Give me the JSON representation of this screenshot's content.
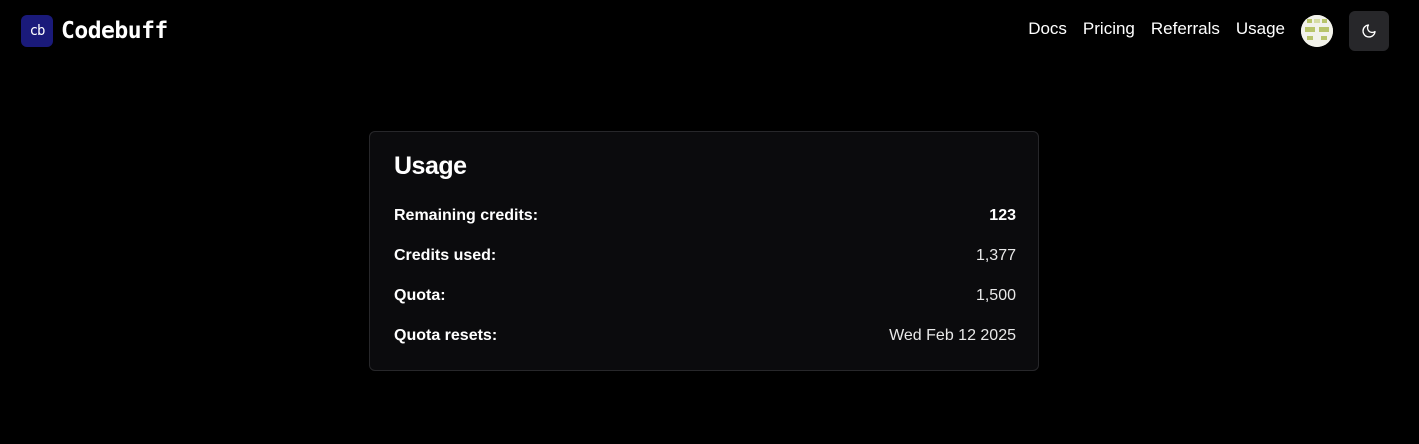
{
  "header": {
    "logo_text": "cb",
    "brand_name": "Codebuff",
    "nav": [
      {
        "label": "Docs"
      },
      {
        "label": "Pricing"
      },
      {
        "label": "Referrals"
      },
      {
        "label": "Usage"
      }
    ],
    "avatar_icon": "user-avatar",
    "theme_toggle_icon": "moon-icon"
  },
  "usage": {
    "title": "Usage",
    "rows": [
      {
        "label": "Remaining credits:",
        "value": "123"
      },
      {
        "label": "Credits used:",
        "value": "1,377"
      },
      {
        "label": "Quota:",
        "value": "1,500"
      },
      {
        "label": "Quota resets:",
        "value": "Wed Feb 12 2025"
      }
    ]
  },
  "colors": {
    "background": "#000000",
    "card_background": "#0b0b0d",
    "card_border": "#27272a",
    "logo_background": "#1a1a7a",
    "theme_button_background": "#27272a"
  }
}
